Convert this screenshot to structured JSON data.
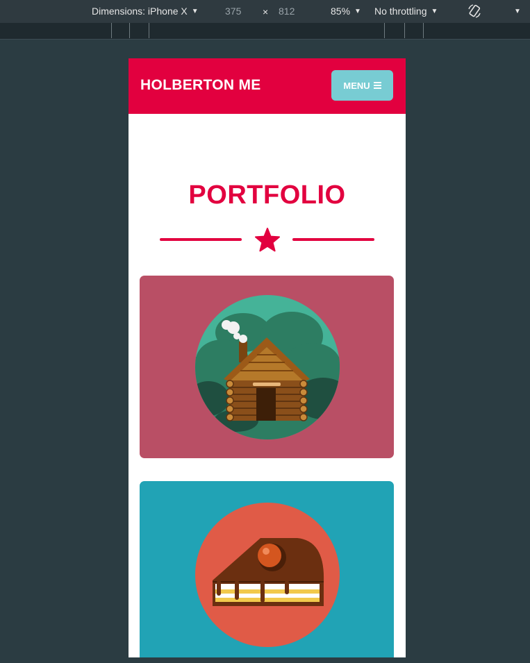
{
  "devtools": {
    "dimensions_label": "Dimensions: iPhone X",
    "width_value": "375",
    "times": "×",
    "height_value": "812",
    "zoom": "85%",
    "throttling": "No throttling"
  },
  "site": {
    "brand": "HOLBERTON ME",
    "menu_label": "MENU",
    "section_title": "PORTFOLIO",
    "colors": {
      "primary": "#e2003f",
      "menu_button": "#78ccd3",
      "card1_bg": "#b94f65",
      "card2_bg": "#21a3b5"
    },
    "portfolio": [
      {
        "icon": "log-cabin-icon"
      },
      {
        "icon": "cake-slice-icon"
      }
    ]
  }
}
